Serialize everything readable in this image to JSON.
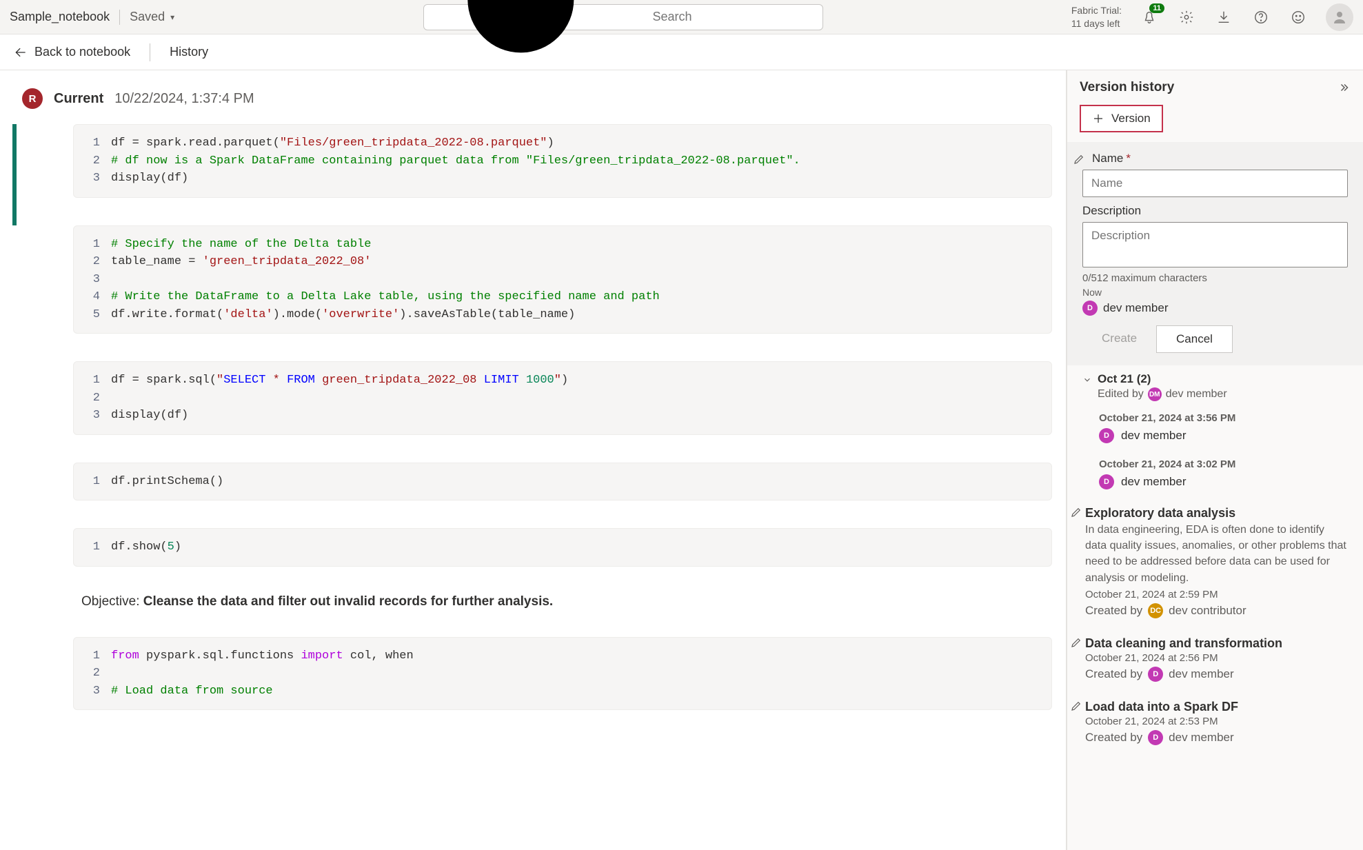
{
  "topbar": {
    "notebook_name": "Sample_notebook",
    "saved_label": "Saved",
    "search_placeholder": "Search",
    "trial_line1": "Fabric Trial:",
    "trial_line2": "11 days left",
    "notif_count": "11"
  },
  "nav": {
    "back_label": "Back to notebook",
    "crumb": "History"
  },
  "current": {
    "avatar_initial": "R",
    "label": "Current",
    "timestamp": "10/22/2024, 1:37:4 PM"
  },
  "cells": [
    {
      "type": "code",
      "active": true,
      "lines": [
        {
          "n": "1",
          "tokens": [
            {
              "t": "df = spark.read.parquet("
            },
            {
              "t": "\"Files/green_tripdata_2022-08.parquet\"",
              "c": "str"
            },
            {
              "t": ")"
            }
          ]
        },
        {
          "n": "2",
          "tokens": [
            {
              "t": "# df now is a Spark DataFrame containing parquet data from \"Files/green_tripdata_2022-08.parquet\".",
              "c": "cmt"
            }
          ]
        },
        {
          "n": "3",
          "tokens": [
            {
              "t": "display(df)"
            }
          ]
        }
      ]
    },
    {
      "type": "code",
      "lines": [
        {
          "n": "1",
          "tokens": [
            {
              "t": "# Specify the name of the Delta table",
              "c": "cmt"
            }
          ]
        },
        {
          "n": "2",
          "tokens": [
            {
              "t": "table_name = "
            },
            {
              "t": "'green_tripdata_2022_08'",
              "c": "str"
            }
          ]
        },
        {
          "n": "3",
          "tokens": [
            {
              "t": ""
            }
          ]
        },
        {
          "n": "4",
          "tokens": [
            {
              "t": "# Write the DataFrame to a Delta Lake table, using the specified name and path",
              "c": "cmt"
            }
          ]
        },
        {
          "n": "5",
          "tokens": [
            {
              "t": "df.write.format("
            },
            {
              "t": "'delta'",
              "c": "str"
            },
            {
              "t": ").mode("
            },
            {
              "t": "'overwrite'",
              "c": "str"
            },
            {
              "t": ").saveAsTable(table_name)"
            }
          ]
        }
      ]
    },
    {
      "type": "code",
      "lines": [
        {
          "n": "1",
          "tokens": [
            {
              "t": "df = spark.sql("
            },
            {
              "t": "\"",
              "c": "str"
            },
            {
              "t": "SELECT",
              "c": "kw"
            },
            {
              "t": " * ",
              "c": "str"
            },
            {
              "t": "FROM",
              "c": "kw"
            },
            {
              "t": " green_tripdata_2022_08 ",
              "c": "str"
            },
            {
              "t": "LIMIT",
              "c": "kw"
            },
            {
              "t": " ",
              "c": "str"
            },
            {
              "t": "1000",
              "c": "num"
            },
            {
              "t": "\"",
              "c": "str"
            },
            {
              "t": ")"
            }
          ]
        },
        {
          "n": "2",
          "tokens": [
            {
              "t": ""
            }
          ]
        },
        {
          "n": "3",
          "tokens": [
            {
              "t": "display(df)"
            }
          ]
        }
      ]
    },
    {
      "type": "code",
      "lines": [
        {
          "n": "1",
          "tokens": [
            {
              "t": "df.printSchema()"
            }
          ]
        }
      ]
    },
    {
      "type": "code",
      "lines": [
        {
          "n": "1",
          "tokens": [
            {
              "t": "df.show("
            },
            {
              "t": "5",
              "c": "num"
            },
            {
              "t": ")"
            }
          ]
        }
      ]
    },
    {
      "type": "md",
      "prefix": "Objective: ",
      "bold": "Cleanse the data and filter out invalid records for further analysis."
    },
    {
      "type": "code",
      "lines": [
        {
          "n": "1",
          "tokens": [
            {
              "t": "from",
              "c": "kw2"
            },
            {
              "t": " pyspark.sql.functions "
            },
            {
              "t": "import",
              "c": "kw2"
            },
            {
              "t": " col, when"
            }
          ]
        },
        {
          "n": "2",
          "tokens": [
            {
              "t": ""
            }
          ]
        },
        {
          "n": "3",
          "tokens": [
            {
              "t": "# Load data from source",
              "c": "cmt"
            }
          ]
        }
      ]
    }
  ],
  "panel": {
    "title": "Version history",
    "add_version_label": "Version",
    "form": {
      "name_label": "Name",
      "name_placeholder": "Name",
      "desc_label": "Description",
      "desc_placeholder": "Description",
      "char_hint": "0/512 maximum characters",
      "now_label": "Now",
      "user": "dev member",
      "user_initial": "D",
      "create_label": "Create",
      "cancel_label": "Cancel"
    },
    "group": {
      "title": "Oct 21 (2)",
      "edited_prefix": "Edited by",
      "editor_initial": "DM",
      "editor_name": "dev member",
      "items": [
        {
          "ts": "October 21, 2024 at 3:56 PM",
          "name": "dev member",
          "initial": "D"
        },
        {
          "ts": "October 21, 2024 at 3:02 PM",
          "name": "dev member",
          "initial": "D"
        }
      ]
    },
    "named": [
      {
        "title": "Exploratory data analysis",
        "desc": "In data engineering, EDA is often done to identify data quality issues, anomalies, or other problems that need to be addressed before data can be used for analysis or modeling.",
        "ts": "October 21, 2024 at 2:59 PM",
        "by_prefix": "Created by",
        "by_initial": "DC",
        "by_name": "dev contributor",
        "avatar_class": "dc"
      },
      {
        "title": "Data cleaning and transformation",
        "desc": "",
        "ts": "October 21, 2024 at 2:56 PM",
        "by_prefix": "Created by",
        "by_initial": "D",
        "by_name": "dev member",
        "avatar_class": ""
      },
      {
        "title": "Load data into a Spark DF",
        "desc": "",
        "ts": "October 21, 2024 at 2:53 PM",
        "by_prefix": "Created by",
        "by_initial": "D",
        "by_name": "dev member",
        "avatar_class": ""
      }
    ]
  }
}
